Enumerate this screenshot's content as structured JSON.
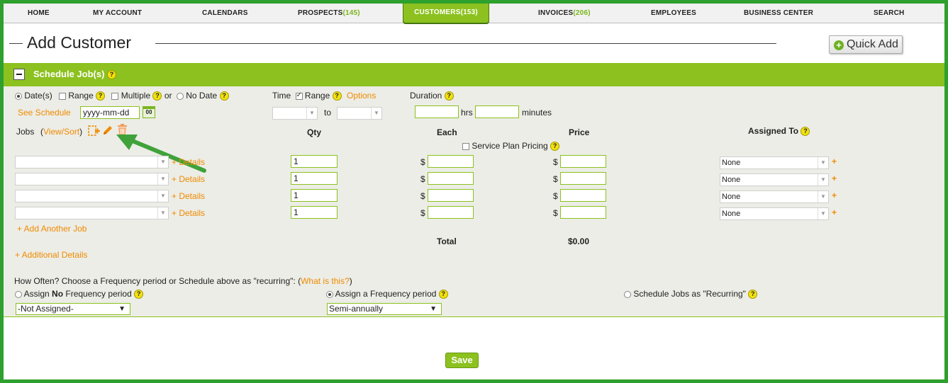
{
  "colors": {
    "accent": "#8cc11f",
    "orange": "#f08a00",
    "border": "#2ea02e",
    "help": "#f2e10c"
  },
  "nav": {
    "home": "HOME",
    "account": "MY ACCOUNT",
    "calendars": "CALENDARS",
    "prospects": "PROSPECTS",
    "prospects_count": "(145)",
    "customers": "CUSTOMERS",
    "customers_count": "(153)",
    "invoices": "INVOICES",
    "invoices_count": "(206)",
    "employees": "EMPLOYEES",
    "business": "BUSINESS CENTER",
    "search": "SEARCH"
  },
  "page": {
    "title": "Add Customer",
    "quick_add": "Quick Add"
  },
  "section": {
    "title": "Schedule Job(s)",
    "help": "?"
  },
  "dates": {
    "dates_label": "Date(s)",
    "range_label": "Range",
    "multiple_label": "Multiple",
    "or_label": "or",
    "nodate_label": "No Date",
    "see_schedule": "See Schedule",
    "date_placeholder": "yyyy-mm-dd",
    "cal_icon_text": "00"
  },
  "time": {
    "label": "Time",
    "range_label": "Range",
    "options_link": "Options",
    "to_label": "to"
  },
  "duration": {
    "label": "Duration",
    "hrs_label": "hrs",
    "minutes_label": "minutes"
  },
  "jobs": {
    "label": "Jobs",
    "view_sort": "View/Sort",
    "qty_header": "Qty",
    "each_header": "Each",
    "price_header": "Price",
    "assigned_header": "Assigned To",
    "service_plan_pricing": "Service Plan Pricing",
    "details_link": "+ Details",
    "currency": "$",
    "rows": [
      {
        "qty": "1",
        "assigned": "None"
      },
      {
        "qty": "1",
        "assigned": "None"
      },
      {
        "qty": "1",
        "assigned": "None"
      },
      {
        "qty": "1",
        "assigned": "None"
      }
    ],
    "add_another": "+ Add Another Job",
    "total_label": "Total",
    "total_value": "$0.00",
    "additional_details": "+ Additional Details"
  },
  "frequency": {
    "question": "How Often? Choose a Frequency period or Schedule above as \"recurring\": (",
    "what_is_this": "What is this?",
    "question_close": ")",
    "assign_no_prefix": "Assign ",
    "assign_no_bold": "No",
    "assign_no_suffix": " Frequency period",
    "assign_a": "Assign a Frequency period",
    "schedule_recurring": "Schedule Jobs as \"Recurring\"",
    "not_assigned": "-Not Assigned-",
    "semi_annually": "Semi-annually"
  },
  "save_label": "Save"
}
